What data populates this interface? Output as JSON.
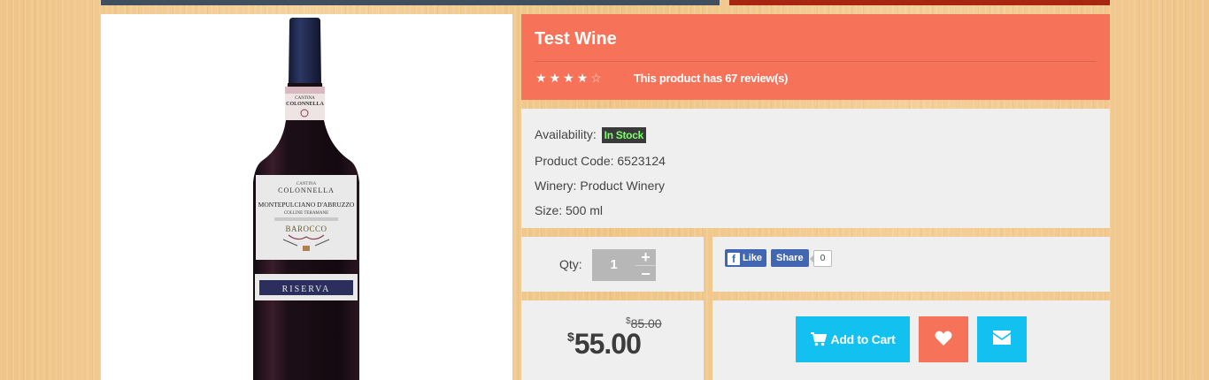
{
  "product": {
    "title": "Test Wine",
    "rating_stars": 4,
    "rating_max": 5,
    "reviews_text": "This product has 67 review(s)"
  },
  "info": {
    "availability_label": "Availability:",
    "availability_value": "In Stock",
    "product_code_label": "Product Code:",
    "product_code_value": "6523124",
    "winery_label": "Winery:",
    "winery_value": "Product Winery",
    "size_label": "Size:",
    "size_value": "500 ml"
  },
  "quantity": {
    "label": "Qty:",
    "value": "1",
    "plus": "+",
    "minus": "−"
  },
  "social": {
    "like_label": "Like",
    "share_label": "Share",
    "share_count": "0"
  },
  "price": {
    "currency": "$",
    "old_amount": "85.00",
    "new_amount": "55.00"
  },
  "actions": {
    "add_to_cart_label": "Add to Cart"
  },
  "bottle_label": {
    "brand": "COLONNELLA",
    "cantina": "CANTINA",
    "wine_name": "MONTEPULCIANO D'ABRUZZO",
    "sub": "COLLINE TERAMANE",
    "style": "BAROCCO",
    "grade": "RISERVA"
  },
  "colors": {
    "accent_coral": "#f6735a",
    "accent_cyan": "#12c1f0",
    "panel_gray": "#efefef",
    "in_stock_green": "#7bff6a"
  },
  "icons": {
    "cart": "shopping-cart-icon",
    "wishlist": "heart-icon",
    "email": "envelope-icon",
    "facebook": "facebook-icon",
    "star": "star-icon"
  }
}
